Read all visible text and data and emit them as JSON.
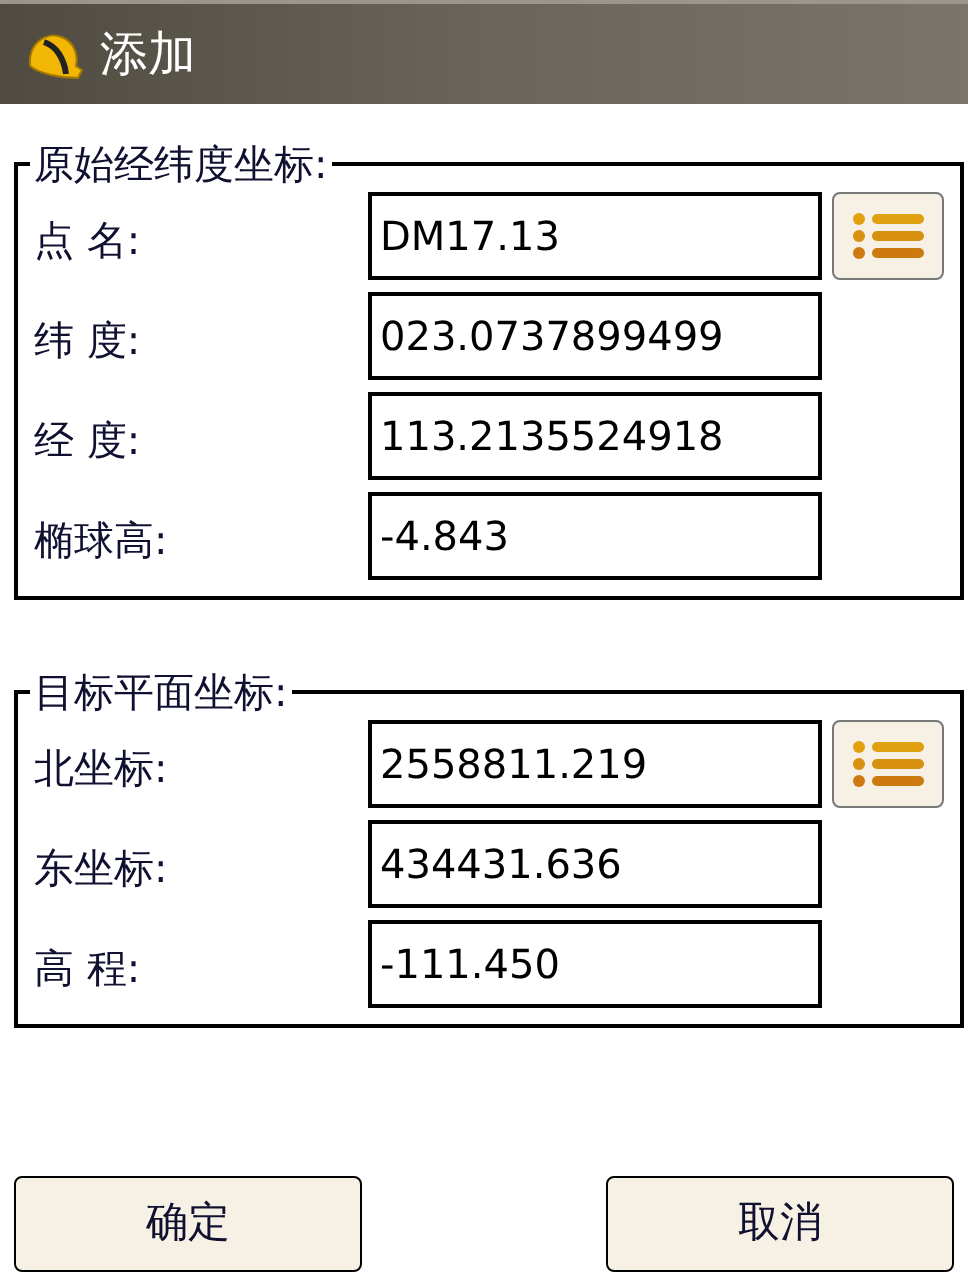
{
  "window": {
    "title": "添加"
  },
  "groups": [
    {
      "title": "原始经纬度坐标:",
      "fields": [
        {
          "label": "点 名:",
          "value": "DM17.13",
          "list_button": true
        },
        {
          "label": "纬 度:",
          "value": "023.0737899499",
          "list_button": false
        },
        {
          "label": "经 度:",
          "value": "113.2135524918",
          "list_button": false
        },
        {
          "label": "椭球高:",
          "value": "-4.843",
          "list_button": false
        }
      ]
    },
    {
      "title": "目标平面坐标:",
      "fields": [
        {
          "label": "北坐标:",
          "value": "2558811.219",
          "list_button": true
        },
        {
          "label": "东坐标:",
          "value": "434431.636",
          "list_button": false
        },
        {
          "label": "高 程:",
          "value": "-111.450",
          "list_button": false
        }
      ]
    }
  ],
  "buttons": [
    "确定",
    "取消"
  ]
}
